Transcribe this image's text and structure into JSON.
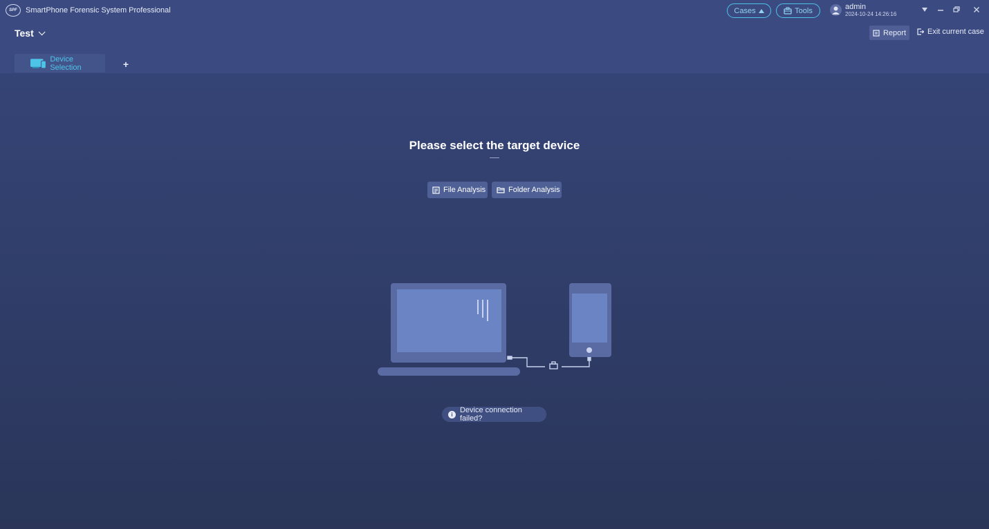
{
  "app": {
    "title": "SmartPhone Forensic System Professional",
    "logo_text": "SPF"
  },
  "header": {
    "cases_label": "Cases",
    "tools_label": "Tools",
    "user_name": "admin",
    "user_time": "2024-10-24 14:26:16"
  },
  "case": {
    "name": "Test",
    "report_label": "Report",
    "exit_label": "Exit current case"
  },
  "tabs": [
    {
      "label": "Device Selection",
      "active": true
    }
  ],
  "main": {
    "headline": "Please select the target device",
    "file_analysis_label": "File Analysis",
    "folder_analysis_label": "Folder Analysis",
    "connection_failed_label": "Device connection failed?"
  },
  "colors": {
    "accent": "#4ec3e8",
    "background": "#313f6c",
    "bar": "#3b4b82",
    "device_fill": "#5a6aa3",
    "screen_fill": "#6b84c4"
  }
}
